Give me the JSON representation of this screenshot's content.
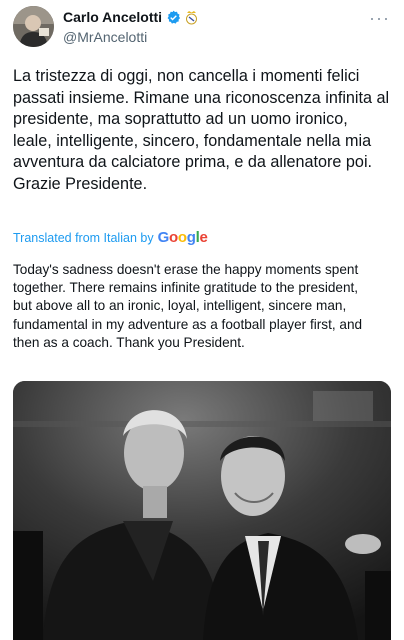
{
  "header": {
    "display_name": "Carlo Ancelotti",
    "handle": "@MrAncelotti",
    "more": "···"
  },
  "tweet": {
    "text": "La tristezza di oggi, non cancella i momenti felici\npassati insieme. Rimane una riconoscenza infinita al\npresidente, ma soprattutto ad un uomo ironico,\nleale, intelligente, sincero, fondamentale nella mia\navventura da calciatore prima, e da allenatore poi.\nGrazie Presidente.",
    "translated_label": "Translated from Italian by",
    "translator": "Google",
    "translation": "Today's sadness doesn't erase the happy moments spent\ntogether. There remains infinite gratitude to the president,\nbut above all to an ironic, loyal, intelligent, sincere man,\nfundamental in my adventure as a football player first, and\nthen as a coach. Thank you President."
  },
  "colors": {
    "link": "#1d9bf0",
    "secondary_text": "#536471",
    "google_blue": "#4285F4",
    "google_red": "#EA4335",
    "google_yellow": "#FBBC05",
    "google_green": "#34A853"
  },
  "icons": {
    "verified": "verified-badge-icon",
    "crest": "real-madrid-crest-icon",
    "more": "more-options-icon"
  }
}
